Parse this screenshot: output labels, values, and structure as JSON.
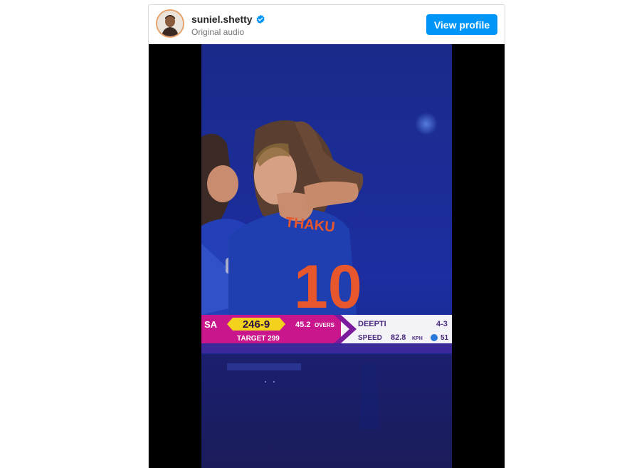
{
  "post": {
    "username": "suniel.shetty",
    "subtitle": "Original audio",
    "verified": true,
    "view_profile_label": "View profile"
  },
  "video_overlay": {
    "jersey_name": "THAKU",
    "jersey_number": "10",
    "team": "SA",
    "score": "246-9",
    "overs_value": "45.2",
    "overs_label": "OVERS",
    "target_label": "TARGET 299",
    "bowler": "DEEPTI",
    "bowler_figures": "4-3",
    "speed_label": "SPEED",
    "speed_value": "82.8",
    "speed_unit": "KPH",
    "trailing_value": "51"
  },
  "colors": {
    "accent": "#0095f6",
    "scorebar_magenta": "#c9168d",
    "score_yellow": "#f2d21c",
    "jersey_blue": "#1f3fb0",
    "jersey_number_orange": "#e8572c"
  },
  "icons": {
    "verified": "verified-badge-icon",
    "avatar": "avatar"
  }
}
